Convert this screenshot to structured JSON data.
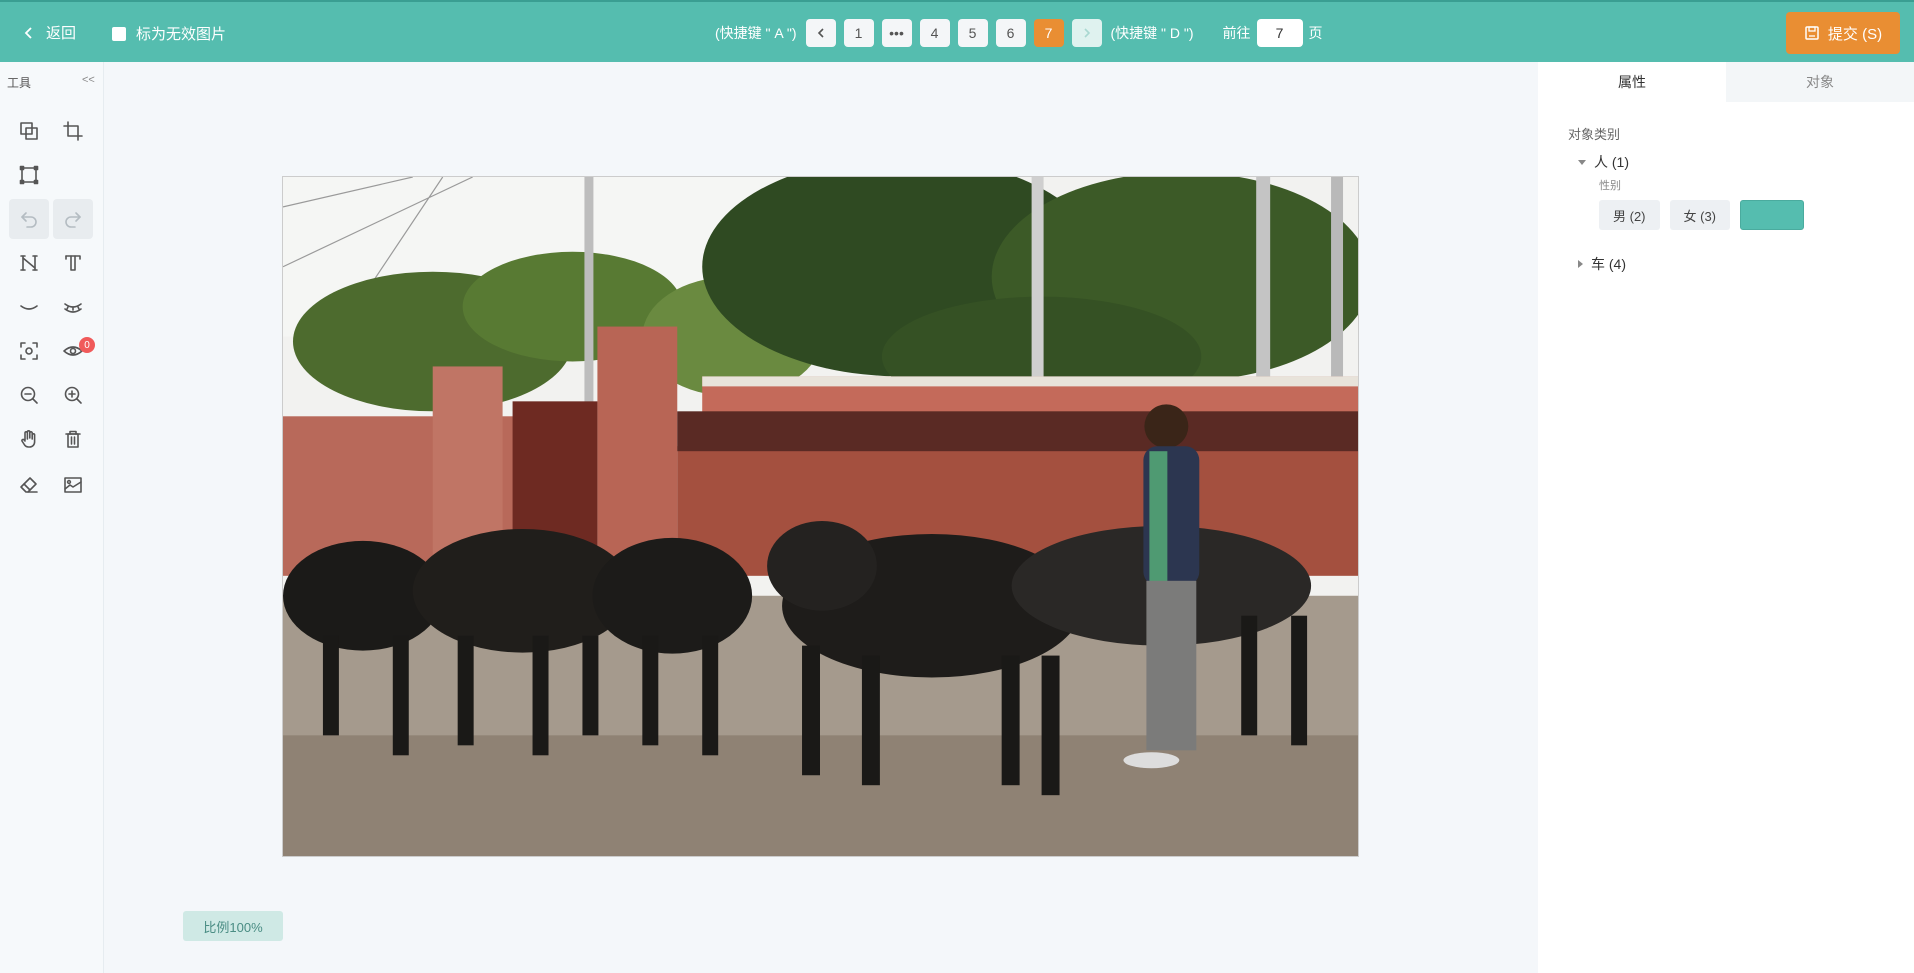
{
  "topbar": {
    "back_label": "返回",
    "invalid_label": "标为无效图片",
    "prev_hint": "(快捷键 \" A \")",
    "next_hint": "(快捷键 \" D \")",
    "pages": [
      "1",
      "•••",
      "4",
      "5",
      "6",
      "7"
    ],
    "current_page": "7",
    "goto_label": "前往",
    "goto_value": "7",
    "goto_suffix": "页",
    "submit_label": "提交 (S)"
  },
  "tools": {
    "title": "工具",
    "collapse": "<<",
    "eye_badge": "0",
    "icons": [
      "copy-box-icon",
      "crop-box-icon",
      "rect-box-icon",
      "undo-icon",
      "redo-icon",
      "h-tool-icon",
      "t-tool-icon",
      "eye-closed-icon",
      "eye-lashes-icon",
      "focus-icon",
      "eye-icon",
      "zoom-out-icon",
      "zoom-in-icon",
      "hand-icon",
      "trash-icon",
      "eraser-icon",
      "image-icon"
    ]
  },
  "canvas": {
    "scale_label": "比例100%"
  },
  "panel": {
    "tabs": [
      "属性",
      "对象"
    ],
    "section_title": "对象类别",
    "categories": [
      {
        "label": "人 (1)",
        "expanded": true
      },
      {
        "label": "车 (4)",
        "expanded": false
      }
    ],
    "attr_label": "性别",
    "options": [
      "男 (2)",
      "女 (3)",
      ""
    ]
  },
  "colors": {
    "topbar": "#55bdaf",
    "accent": "#e98e33",
    "selected": "#55bdaf"
  }
}
